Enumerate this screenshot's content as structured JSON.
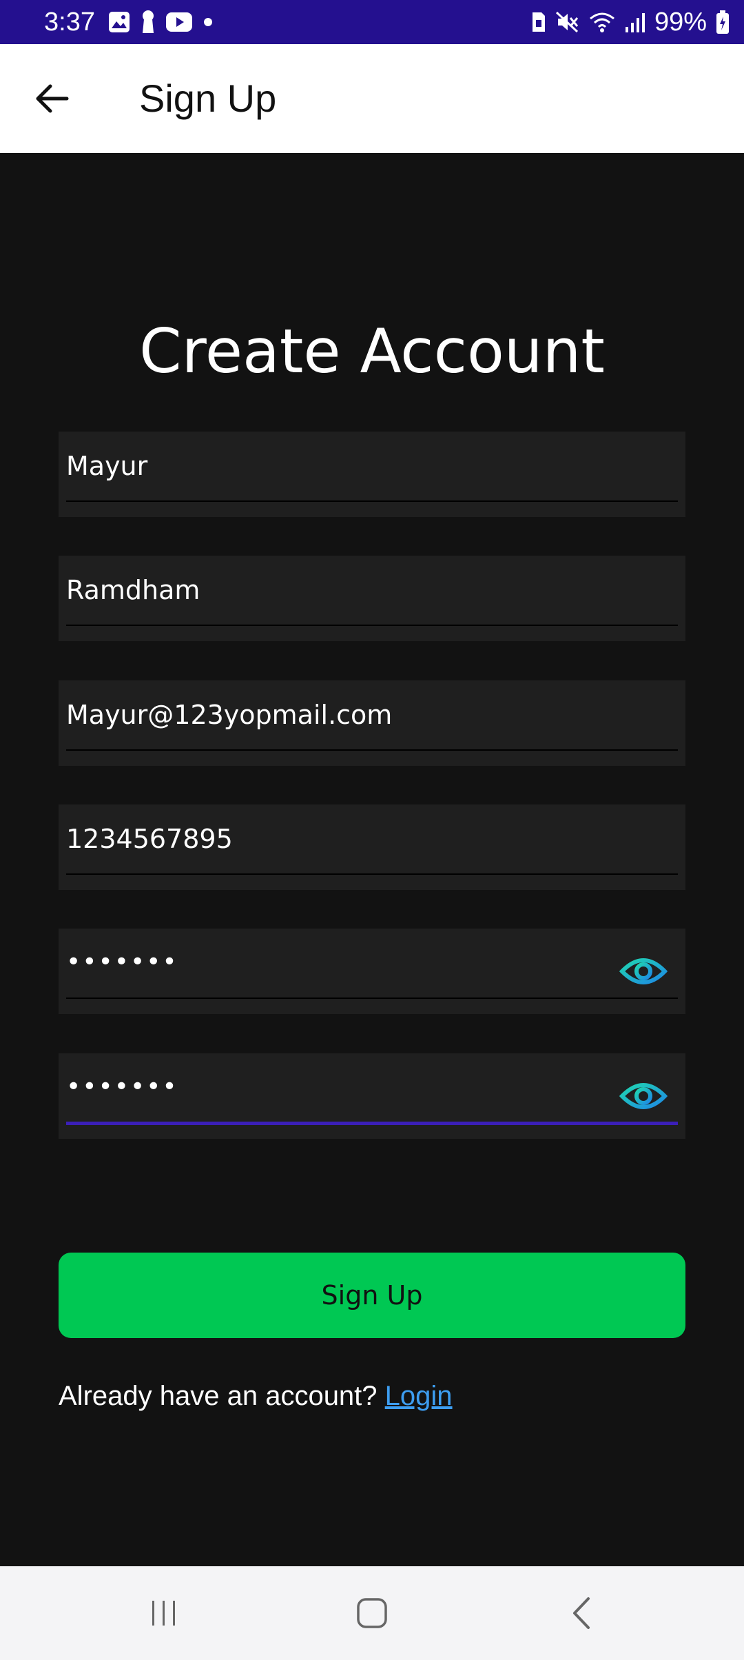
{
  "status_bar": {
    "time": "3:37",
    "battery": "99%",
    "left_icons": [
      "gallery-icon",
      "keyhole-icon",
      "youtube-icon",
      "dot-icon"
    ],
    "right_icons": [
      "sim-icon",
      "mute-icon",
      "wifi-icon",
      "signal-icon",
      "battery-icon"
    ]
  },
  "app_bar": {
    "title": "Sign Up",
    "back_icon": "arrow-left-icon"
  },
  "form": {
    "heading": "Create Account",
    "first_name": "Mayur",
    "last_name": "Ramdham",
    "email": "Mayur@123yopmail.com",
    "phone": "1234567895",
    "password": "•••••••",
    "confirm_password": "•••••••",
    "eye_icon": "eye-icon",
    "accent_color": "#00c853",
    "focus_color": "#3b1fb8",
    "submit_label": "Sign Up"
  },
  "footer": {
    "prompt": "Already have an account?",
    "login_link": "Login",
    "link_color": "#3d9df0"
  },
  "nav_bar": {
    "items": [
      "recent-apps-icon",
      "home-icon",
      "back-icon"
    ]
  }
}
